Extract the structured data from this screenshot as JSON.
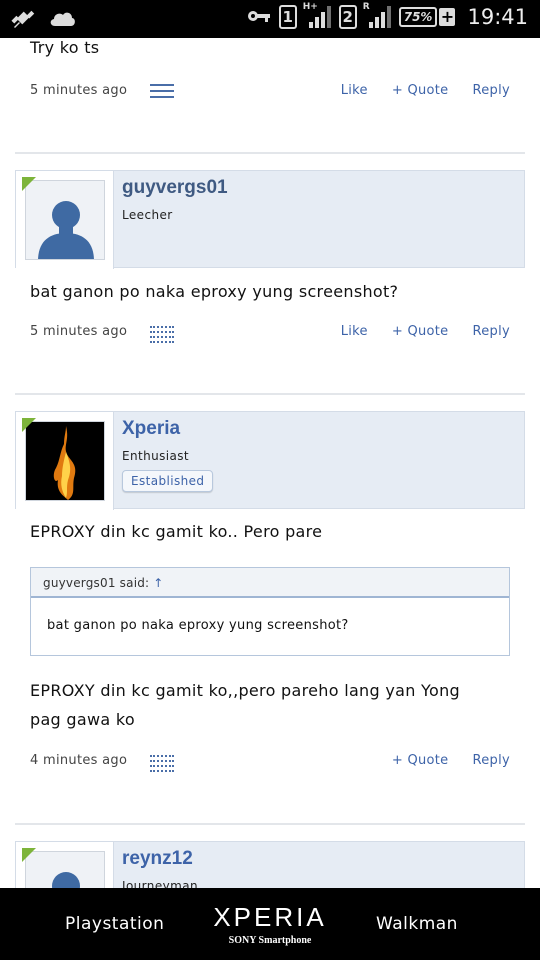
{
  "statusbar": {
    "sim1": "1",
    "sim1_network": "H+",
    "sim2": "2",
    "sim2_network": "R",
    "battery": "75%",
    "time": "19:41"
  },
  "posts": [
    {
      "message": "Try ko ts",
      "time": "5 minutes ago",
      "actions": [
        "Like",
        "+ Quote",
        "Reply"
      ]
    },
    {
      "username": "guyvergs01",
      "role": "Leecher",
      "message": "bat ganon po naka eproxy yung screenshot?",
      "time": "5 minutes ago",
      "actions": [
        "Like",
        "+ Quote",
        "Reply"
      ]
    },
    {
      "username": "Xperia",
      "role": "Enthusiast",
      "badge": "Established",
      "message": "EPROXY din kc gamit ko.. Pero pare",
      "quote": {
        "author": "guyvergs01 said:",
        "text": "bat ganon po naka eproxy yung screenshot?"
      },
      "message2_line1": "EPROXY din kc gamit ko,,pero pareho lang yan Yong",
      "message2_line2": "pag gawa ko",
      "time": "4 minutes ago",
      "actions": [
        "+ Quote",
        "Reply"
      ]
    },
    {
      "username": "reynz12",
      "role": "Journeyman"
    }
  ],
  "bottombar": {
    "left": "Playstation",
    "brand": "XPERIA",
    "brand_sub": "SONY Smartphone",
    "right": "Walkman"
  },
  "colors": {
    "accent": "#3d63a8",
    "user_block": "#e6ecf4",
    "corner": "#7db43a"
  }
}
